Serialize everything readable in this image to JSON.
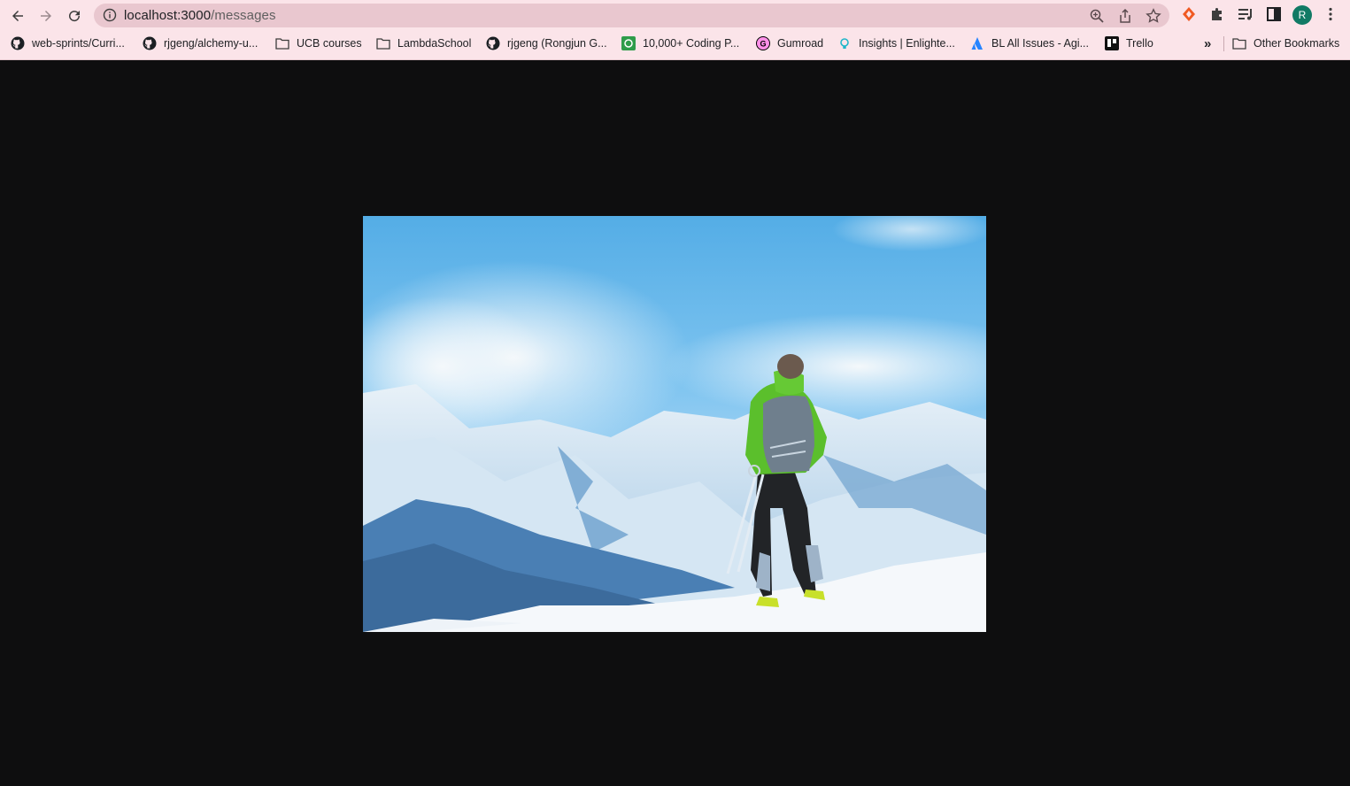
{
  "browser": {
    "url_host": "localhost:3000",
    "url_path": "/messages",
    "profile_initial": "R"
  },
  "bookmarks": [
    {
      "label": "web-sprints/Curri...",
      "icon": "github-icon"
    },
    {
      "label": "rjgeng/alchemy-u...",
      "icon": "github-icon"
    },
    {
      "label": "UCB courses",
      "icon": "folder-icon"
    },
    {
      "label": "LambdaSchool",
      "icon": "folder-icon"
    },
    {
      "label": "rjgeng (Rongjun G...",
      "icon": "github-icon"
    },
    {
      "label": "10,000+ Coding P...",
      "icon": "coding-icon"
    },
    {
      "label": "Gumroad",
      "icon": "gumroad-icon"
    },
    {
      "label": "Insights | Enlighte...",
      "icon": "lightbulb-icon"
    },
    {
      "label": "BL All Issues - Agi...",
      "icon": "atlassian-icon"
    },
    {
      "label": "Trello",
      "icon": "trello-icon"
    }
  ],
  "bookmarks_overflow": "»",
  "other_bookmarks": "Other Bookmarks",
  "colors": {
    "chrome_bg": "#fbe4e9",
    "omnibox_bg": "#e9c7cf",
    "page_bg": "#0e0e0f",
    "avatar_bg": "#117a65"
  },
  "photo": {
    "subject": "skier-on-snowy-mountain-photo"
  }
}
